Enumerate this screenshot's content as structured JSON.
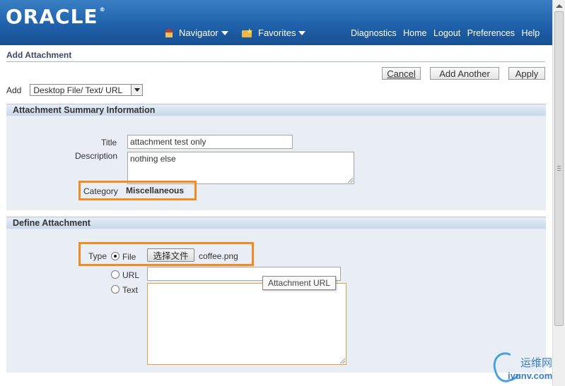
{
  "header": {
    "logo": "ORACLE",
    "navigator": "Navigator",
    "favorites": "Favorites",
    "links": [
      "Diagnostics",
      "Home",
      "Logout",
      "Preferences",
      "Help"
    ]
  },
  "page": {
    "title": "Add Attachment",
    "buttons": {
      "cancel": "Cancel",
      "add_another": "Add Another",
      "apply": "Apply"
    },
    "add_label": "Add",
    "add_select_value": "Desktop File/ Text/ URL"
  },
  "summary": {
    "header": "Attachment Summary Information",
    "title_label": "Title",
    "title_value": "attachment test only",
    "description_label": "Description",
    "description_value": "nothing else",
    "category_label": "Category",
    "category_value": "Miscellaneous"
  },
  "define": {
    "header": "Define Attachment",
    "type_label": "Type",
    "options": {
      "file": "File",
      "url": "URL",
      "text": "Text"
    },
    "selected": "file",
    "file_button": "选择文件",
    "file_name": "coffee.png",
    "url_tooltip": "Attachment URL"
  },
  "watermark": {
    "cn": "运维网",
    "en": "iyunv.com"
  },
  "colors": {
    "header_blue": "#1f62ab",
    "highlight_orange": "#f28b22",
    "section_bg": "#e9eef4"
  }
}
